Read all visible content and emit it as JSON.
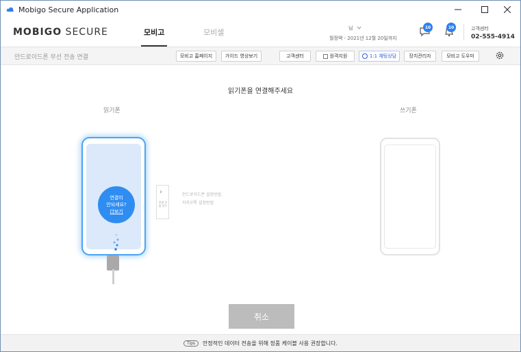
{
  "window": {
    "title": "Mobigo Secure Application"
  },
  "header": {
    "logo_bold": "MOBIGO",
    "logo_light": " SECURE",
    "tabs": [
      {
        "label": "모비고",
        "active": true
      },
      {
        "label": "모비셀",
        "active": false
      }
    ],
    "account_name": "님",
    "expiry": "월정액 - 2021년 12월 20일까지",
    "chat_badge": "10",
    "notification_badge": "10",
    "customer_center_label": "고객센터",
    "customer_center_phone": "02-555-4914"
  },
  "toolbar": {
    "subtitle": "안드로이드폰 무선 전송 연결",
    "buttons": [
      "모비고 홈페이지",
      "가이드 영상보기",
      "고객센터",
      "원격지원",
      "1:1 채팅상담",
      "장치관리자",
      "모비고 도우미"
    ]
  },
  "main": {
    "instruction": "읽기폰을 연결해주세요",
    "read_label": "읽기폰",
    "write_label": "쓰기폰",
    "circle_line1": "연결이",
    "circle_line2": "안되세요?",
    "circle_more": "더보기",
    "guide_panel_text": "연결 안 될 경우",
    "guide_links": [
      "안드로이드폰 설정방법",
      "카카오톡 설정방법"
    ],
    "cancel_label": "취소"
  },
  "footer": {
    "tips": "Tips",
    "message": "안정적인 데이터 전송을 위해 정품 케이블 사용 권장합니다."
  },
  "colors": {
    "accent": "#2f8df2",
    "badge": "#2f80ed",
    "cancel": "#bcbcbc"
  }
}
